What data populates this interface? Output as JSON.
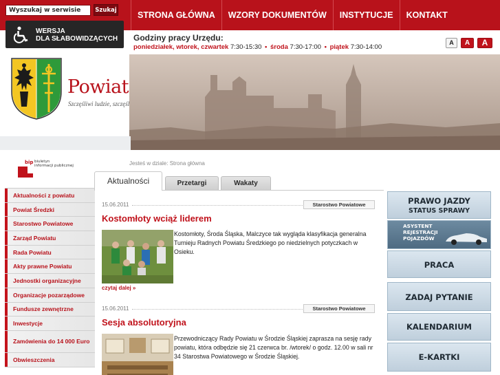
{
  "search": {
    "placeholder": "Wyszukaj w serwisie",
    "button": "Szukaj"
  },
  "nav": [
    "STRONA GŁÓWNA",
    "WZORY DOKUMENTÓW",
    "INSTYTUCJE",
    "KONTAKT"
  ],
  "accessibility": {
    "line1": "WERSJA",
    "line2": "DLA SŁABOWIDZĄCYCH"
  },
  "hours": {
    "title": "Godziny pracy Urzędu:",
    "days1": "poniedziałek, wtorek, czwartek",
    "time1": "7:30-15:30",
    "days2": "środa",
    "time2": "7:30-17:00",
    "days3": "piątek",
    "time3": "7:30-14:00",
    "separator": "•"
  },
  "font_size": [
    "A",
    "A",
    "A"
  ],
  "logo": {
    "title": "Powiat Średzki",
    "subtitle": "Szczęśliwi ludzie, szczęśliwe miejsce"
  },
  "bip": {
    "mark": "bip",
    "line1": "biuletyn",
    "line2": "informacji publicznej"
  },
  "breadcrumb": "Jesteś w dziale: Strona główna",
  "tabs": [
    "Aktualności",
    "Przetargi",
    "Wakaty"
  ],
  "sidebar": {
    "items": [
      "Aktualności z powiatu",
      "Powiat Średzki",
      "Starostwo Powiatowe",
      "Zarząd Powiatu",
      "Rada Powiatu",
      "Akty prawne Powiatu",
      "Jednostki organizacyjne",
      "Organizacje pozarządowe",
      "Fundusze zewnętrzne",
      "Inwestycje",
      "Zamówienia do 14 000 Euro",
      "Obwieszczenia"
    ]
  },
  "articles": [
    {
      "date": "15.06.2011",
      "tag": "Starostwo Powiatowe",
      "title": "Kostomłoty wciąż liderem",
      "body": "Kostomłoty, Środa Śląska, Malczyce tak wygląda klasyfikacja generalna Turnieju Radnych Powiatu Średzkiego po niedzielnych potyczkach w Osieku.",
      "more": "czytaj dalej »"
    },
    {
      "date": "15.06.2011",
      "tag": "Starostwo Powiatowe",
      "title": "Sesja absolutoryjna",
      "body": "Przewodniczący Rady Powiatu w Środzie Śląskiej zaprasza na sesję rady powiatu, która odbędzie się 21 czerwca br. /wtorek/ o godz. 12.00 w sali nr 34 Starostwa Powiatowego w Środzie Śląskiej."
    }
  ],
  "right_tiles": [
    {
      "line1": "PRAWO JAZDY",
      "line2": "STATUS SPRAWY"
    },
    {
      "line1": "ASYSTENT",
      "line2": "REJESTRACJI",
      "line3": "POJAZDÓW"
    },
    {
      "line1": "PRACA"
    },
    {
      "line1": "ZADAJ PYTANIE"
    },
    {
      "line1": "KALENDARIUM"
    },
    {
      "line1": "E-KARTKI"
    }
  ]
}
